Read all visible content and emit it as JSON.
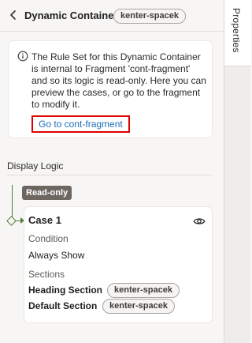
{
  "header": {
    "title": "Dynamic Container",
    "tag": "kenter-spacek"
  },
  "notice": {
    "text": "The Rule Set for this Dynamic Container is internal to Fragment 'cont-fragment' and so its logic is read-only. Here you can preview the cases, or go to the fragment to modify it.",
    "link_label": "Go to cont-fragment"
  },
  "display_logic": {
    "title": "Display Logic",
    "badge": "Read-only"
  },
  "case": {
    "title": "Case 1",
    "condition_label": "Condition",
    "condition_value": "Always Show",
    "sections_label": "Sections",
    "sections": [
      {
        "name": "Heading Section",
        "tag": "kenter-spacek"
      },
      {
        "name": "Default Section",
        "tag": "kenter-spacek"
      }
    ]
  },
  "rail": {
    "tab_label": "Properties"
  },
  "colors": {
    "link": "#1d6fb8",
    "highlight_border": "#e00000",
    "tree_line": "#4f7f3a",
    "badge_bg": "#6e6661"
  },
  "icons": [
    "chevron-left-icon",
    "info-icon",
    "eye-icon"
  ]
}
